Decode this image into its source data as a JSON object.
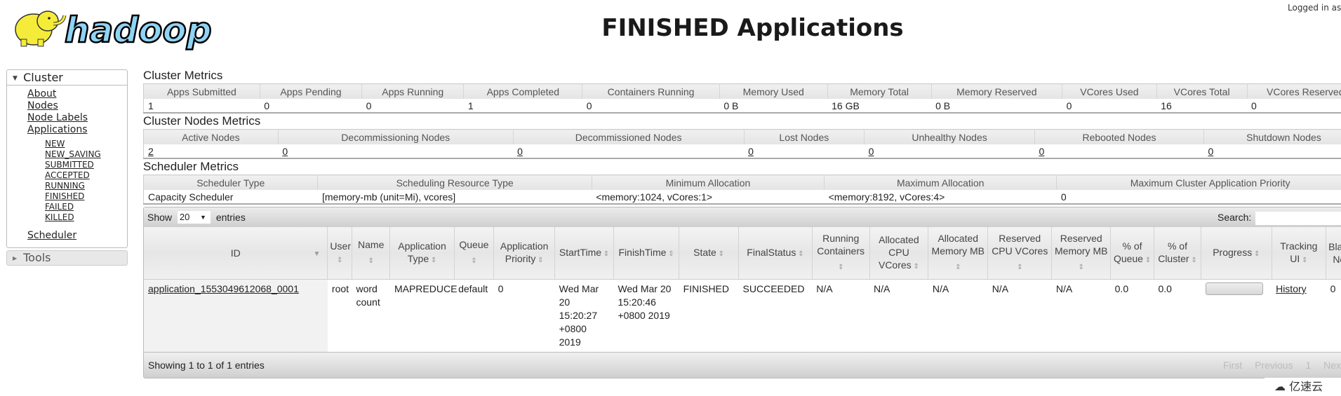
{
  "header": {
    "logo_text": "hadoop",
    "title": "FINISHED Applications",
    "logged_in": "Logged in as"
  },
  "sidebar": {
    "cluster_label": "Cluster",
    "items": [
      "About",
      "Nodes",
      "Node Labels",
      "Applications"
    ],
    "app_states": [
      "NEW",
      "NEW_SAVING",
      "SUBMITTED",
      "ACCEPTED",
      "RUNNING",
      "FINISHED",
      "FAILED",
      "KILLED"
    ],
    "scheduler": "Scheduler",
    "tools_label": "Tools"
  },
  "cluster_metrics": {
    "title": "Cluster Metrics",
    "headers": [
      "Apps Submitted",
      "Apps Pending",
      "Apps Running",
      "Apps Completed",
      "Containers Running",
      "Memory Used",
      "Memory Total",
      "Memory Reserved",
      "VCores Used",
      "VCores Total",
      "VCores Reserved"
    ],
    "values": [
      "1",
      "0",
      "0",
      "1",
      "0",
      "0 B",
      "16 GB",
      "0 B",
      "0",
      "16",
      "0"
    ]
  },
  "nodes_metrics": {
    "title": "Cluster Nodes Metrics",
    "headers": [
      "Active Nodes",
      "Decommissioning Nodes",
      "Decommissioned Nodes",
      "Lost Nodes",
      "Unhealthy Nodes",
      "Rebooted Nodes",
      "Shutdown Nodes"
    ],
    "values": [
      "2",
      "0",
      "0",
      "0",
      "0",
      "0",
      "0"
    ]
  },
  "scheduler_metrics": {
    "title": "Scheduler Metrics",
    "headers": [
      "Scheduler Type",
      "Scheduling Resource Type",
      "Minimum Allocation",
      "Maximum Allocation",
      "Maximum Cluster Application Priority"
    ],
    "values": [
      "Capacity Scheduler",
      "[memory-mb (unit=Mi), vcores]",
      "<memory:1024, vCores:1>",
      "<memory:8192, vCores:4>",
      "0"
    ]
  },
  "apps_table": {
    "show_label": "Show",
    "entries_label": "entries",
    "page_size": "20",
    "search_label": "Search:",
    "search_value": "",
    "columns": [
      "ID",
      "User",
      "Name",
      "Application Type",
      "Queue",
      "Application Priority",
      "StartTime",
      "FinishTime",
      "State",
      "FinalStatus",
      "Running Containers",
      "Allocated CPU VCores",
      "Allocated Memory MB",
      "Reserved CPU VCores",
      "Reserved Memory MB",
      "% of Queue",
      "% of Cluster",
      "Progress",
      "Tracking UI",
      "Blacklisted Nodes"
    ],
    "rows": [
      {
        "id": "application_1553049612068_0001",
        "user": "root",
        "name": "word count",
        "type": "MAPREDUCE",
        "queue": "default",
        "priority": "0",
        "start": "Wed Mar 20 15:20:27 +0800 2019",
        "finish": "Wed Mar 20 15:20:46 +0800 2019",
        "state": "FINISHED",
        "final_status": "SUCCEEDED",
        "running_containers": "N/A",
        "alloc_vcores": "N/A",
        "alloc_mem": "N/A",
        "res_vcores": "N/A",
        "res_mem": "N/A",
        "pct_queue": "0.0",
        "pct_cluster": "0.0",
        "progress": 0,
        "tracking_ui": "History",
        "blacklisted": "0"
      }
    ],
    "footer": "Showing 1 to 1 of 1 entries",
    "pager": [
      "First",
      "Previous",
      "1",
      "Next"
    ]
  },
  "watermark": "亿速云"
}
